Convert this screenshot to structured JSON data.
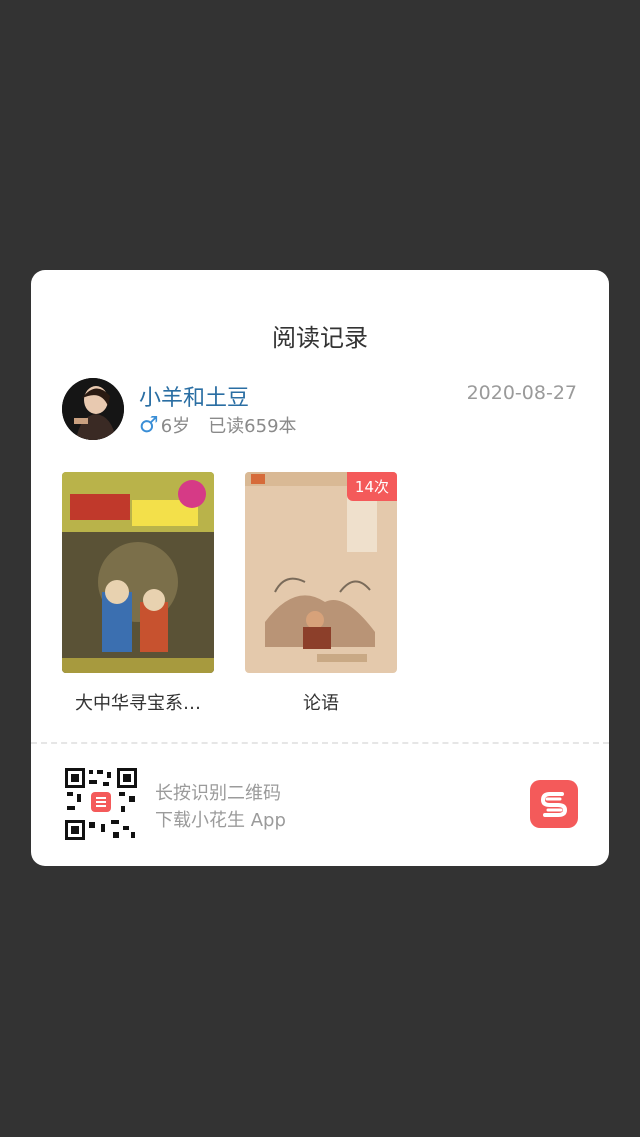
{
  "dialog": {
    "title": "阅读记录",
    "user": {
      "name": "小羊和土豆",
      "gender_icon": "male-icon",
      "gender_symbol": "♂",
      "age": "6岁",
      "read_count": "已读659本",
      "date": "2020-08-27"
    },
    "books": [
      {
        "title": "大中华寻宝系…",
        "badge": ""
      },
      {
        "title": "论语",
        "badge": "14次"
      }
    ],
    "footer": {
      "line1": "长按识别二维码",
      "line2": "下载小花生 App",
      "app_icon": "xiaohuasheng-logo-icon",
      "accent_color": "#f45a5a"
    }
  }
}
